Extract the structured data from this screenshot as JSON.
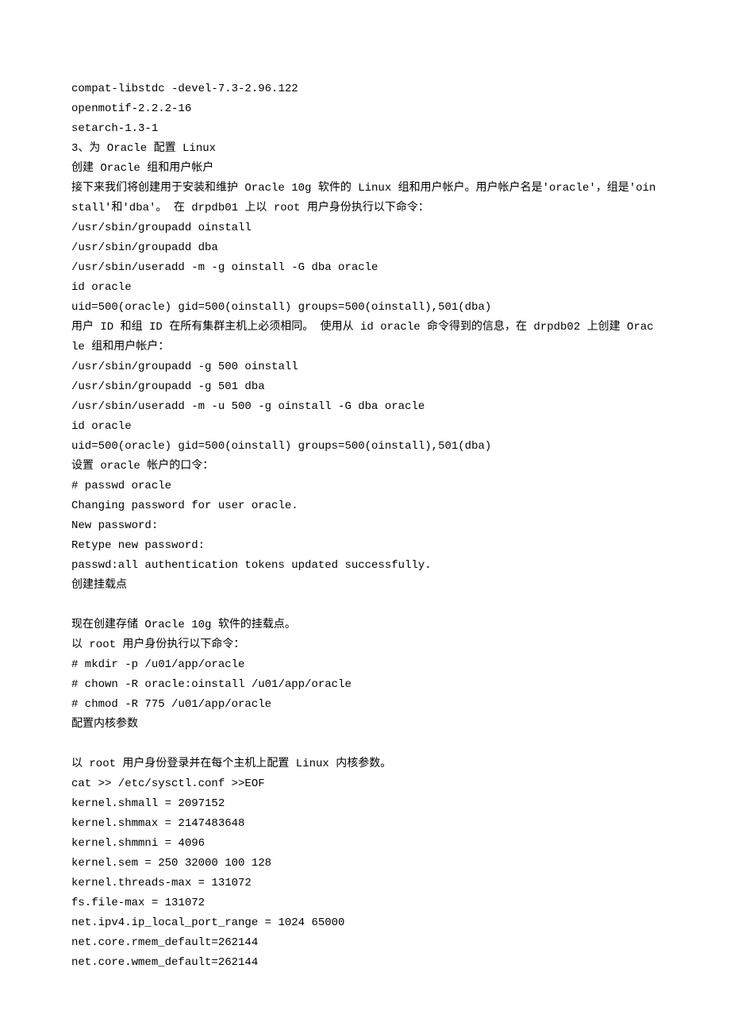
{
  "lines": [
    "compat-libstdc -devel-7.3-2.96.122",
    "openmotif-2.2.2-16",
    "setarch-1.3-1",
    "3、为 Oracle 配置 Linux",
    "创建 Oracle 组和用户帐户",
    "接下来我们将创建用于安装和维护 Oracle 10g 软件的 Linux 组和用户帐户。用户帐户名是'oracle'，组是'oinstall'和'dba'。 在 drpdb01 上以 root 用户身份执行以下命令：",
    "/usr/sbin/groupadd oinstall",
    "/usr/sbin/groupadd dba",
    "/usr/sbin/useradd -m -g oinstall -G dba oracle",
    "id oracle",
    "uid=500(oracle) gid=500(oinstall) groups=500(oinstall),501(dba)",
    "用户 ID 和组 ID 在所有集群主机上必须相同。 使用从 id oracle 命令得到的信息，在 drpdb02 上创建 Oracle 组和用户帐户：",
    "/usr/sbin/groupadd -g 500 oinstall",
    "/usr/sbin/groupadd -g 501 dba",
    "/usr/sbin/useradd -m -u 500 -g oinstall -G dba oracle",
    "id oracle",
    "uid=500(oracle) gid=500(oinstall) groups=500(oinstall),501(dba)",
    "设置 oracle 帐户的口令：",
    "# passwd oracle",
    "Changing password for user oracle.",
    "New password:",
    "Retype new password:",
    "passwd:all authentication tokens updated successfully.",
    "创建挂载点",
    "",
    "现在创建存储 Oracle 10g 软件的挂载点。",
    "以 root 用户身份执行以下命令：",
    "# mkdir -p /u01/app/oracle",
    "# chown -R oracle:oinstall /u01/app/oracle",
    "# chmod -R 775 /u01/app/oracle",
    "配置内核参数",
    "",
    "以 root 用户身份登录并在每个主机上配置 Linux 内核参数。",
    "cat >> /etc/sysctl.conf >>EOF",
    "kernel.shmall = 2097152",
    "kernel.shmmax = 2147483648",
    "kernel.shmmni = 4096",
    "kernel.sem = 250 32000 100 128",
    "kernel.threads-max = 131072",
    "fs.file-max = 131072",
    "net.ipv4.ip_local_port_range = 1024 65000",
    "net.core.rmem_default=262144",
    "net.core.wmem_default=262144"
  ]
}
